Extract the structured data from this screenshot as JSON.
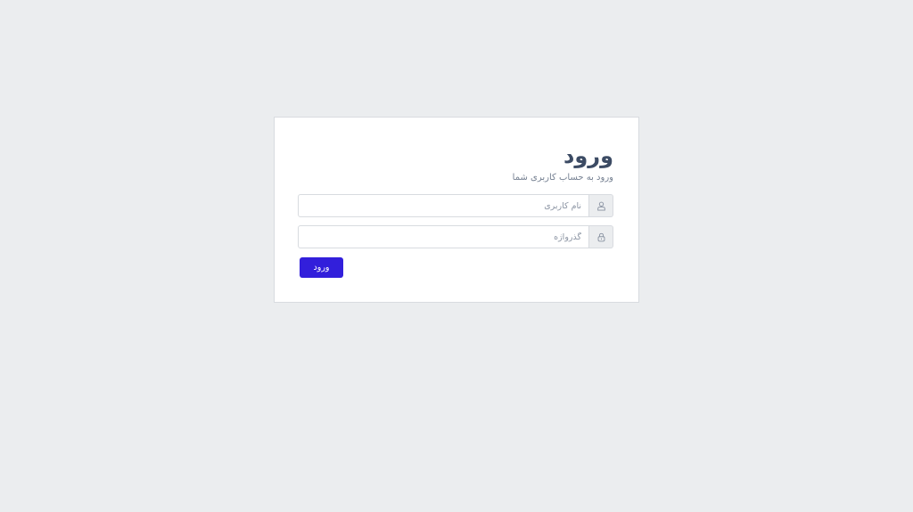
{
  "colors": {
    "background": "#ebedef",
    "card": "#ffffff",
    "heading": "#3c4b64",
    "muted": "#768192",
    "primary": "#321fdb"
  },
  "login": {
    "title": "ورود",
    "subtitle": "ورود به حساب کاربری شما",
    "username": {
      "icon": "user-icon",
      "placeholder": "نام کاربری",
      "value": ""
    },
    "password": {
      "icon": "lock-icon",
      "placeholder": "گذرواژه",
      "value": ""
    },
    "submit_label": "ورود"
  }
}
